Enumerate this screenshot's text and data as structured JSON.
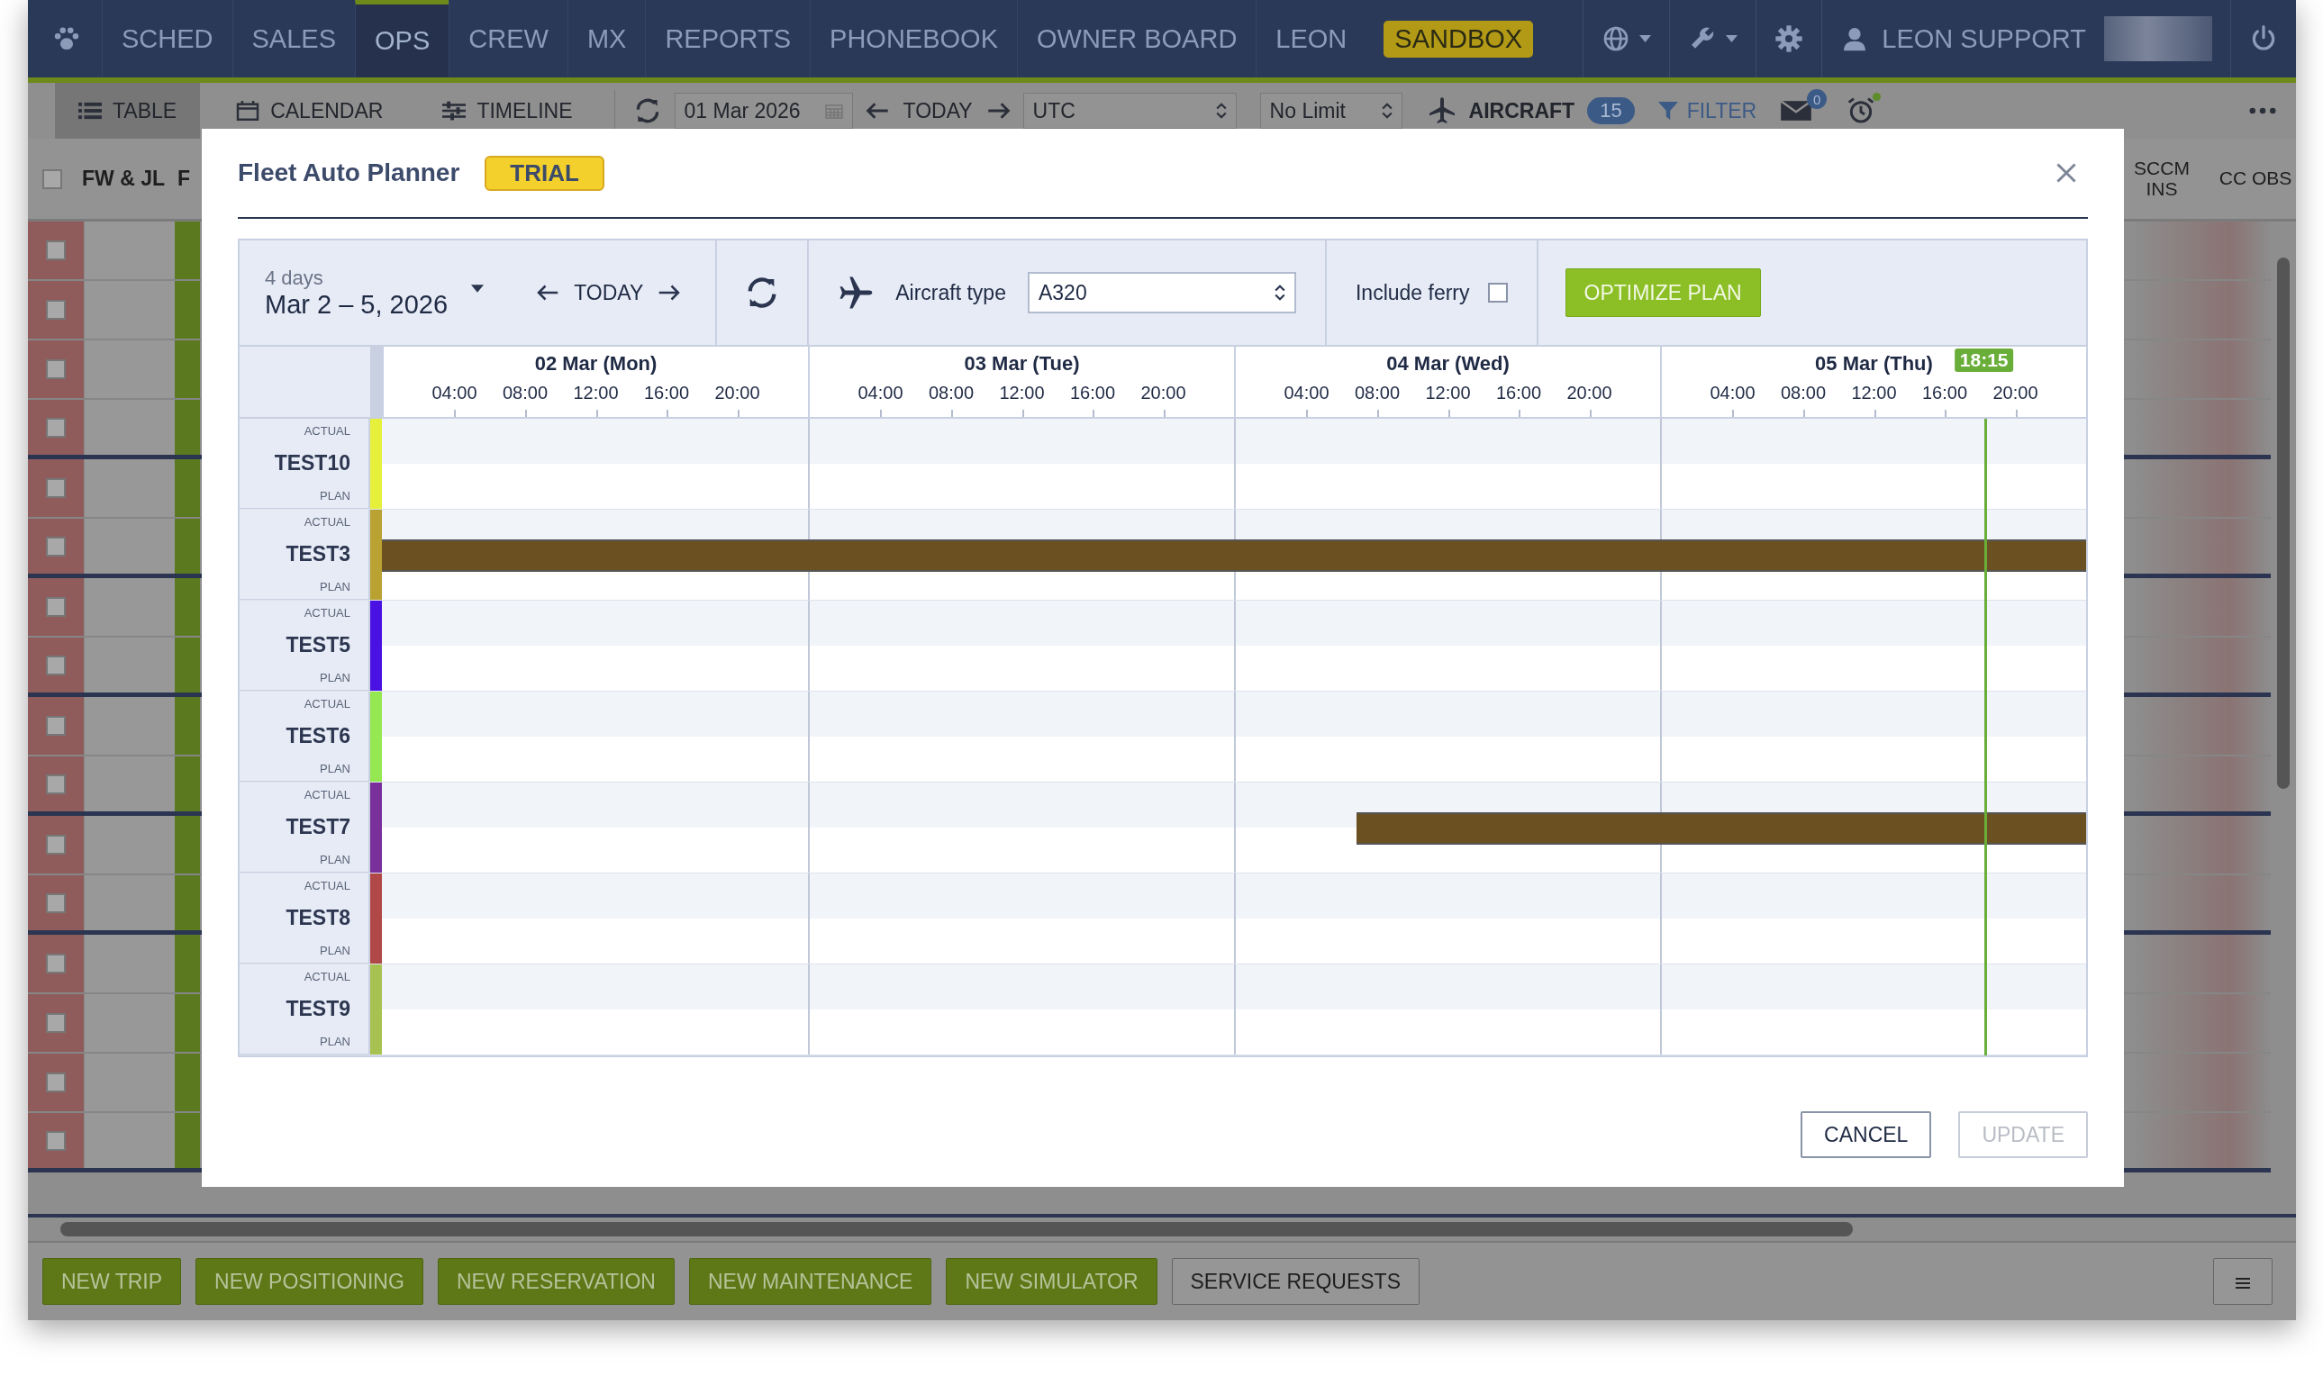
{
  "nav": {
    "items": [
      {
        "label": "SCHED",
        "selected": false
      },
      {
        "label": "SALES",
        "selected": false
      },
      {
        "label": "OPS",
        "selected": true
      },
      {
        "label": "CREW",
        "selected": false
      },
      {
        "label": "MX",
        "selected": false
      },
      {
        "label": "REPORTS",
        "selected": false
      },
      {
        "label": "PHONEBOOK",
        "selected": false
      },
      {
        "label": "OWNER BOARD",
        "selected": false
      },
      {
        "label": "LEON",
        "selected": false
      }
    ],
    "sandbox": "SANDBOX",
    "user": "LEON SUPPORT"
  },
  "toolbar": {
    "views": [
      {
        "label": "TABLE",
        "kind": "table",
        "selected": true
      },
      {
        "label": "CALENDAR",
        "kind": "calendar",
        "selected": false
      },
      {
        "label": "TIMELINE",
        "kind": "timeline",
        "selected": false
      }
    ],
    "date": "01 Mar 2026",
    "today": "TODAY",
    "timezone": "UTC",
    "limit": "No Limit",
    "aircraft": "AIRCRAFT",
    "aircraft_count": "15",
    "filter": "FILTER",
    "mail_count": "0"
  },
  "table": {
    "select_all": {
      "checked": false
    },
    "columns": [
      "FW & JL",
      "F"
    ],
    "right_columns": [
      "SCCM INS",
      "CC OBS"
    ],
    "rows": [
      {
        "checked": false,
        "group_end": false
      },
      {
        "checked": false,
        "group_end": false
      },
      {
        "checked": false,
        "group_end": false
      },
      {
        "checked": false,
        "group_end": true
      },
      {
        "checked": false,
        "group_end": false
      },
      {
        "checked": false,
        "group_end": true
      },
      {
        "checked": false,
        "group_end": false
      },
      {
        "checked": false,
        "group_end": true
      },
      {
        "checked": false,
        "group_end": false
      },
      {
        "checked": false,
        "group_end": true
      },
      {
        "checked": false,
        "group_end": false
      },
      {
        "checked": false,
        "group_end": true
      },
      {
        "checked": false,
        "group_end": false
      },
      {
        "checked": false,
        "group_end": false
      },
      {
        "checked": false,
        "group_end": false
      },
      {
        "checked": false,
        "group_end": true
      }
    ]
  },
  "planner": {
    "title": "Fleet Auto Planner",
    "badge": "TRIAL",
    "range_caption": "4 days",
    "range": "Mar 2 – 5, 2026",
    "today": "TODAY",
    "aircraft_type_label": "Aircraft type",
    "aircraft_type": "A320",
    "include_ferry": {
      "label": "Include ferry",
      "checked": false
    },
    "optimize": "OPTIMIZE PLAN",
    "days": [
      {
        "label": "02 Mar (Mon)",
        "hours": [
          "04:00",
          "08:00",
          "12:00",
          "16:00",
          "20:00"
        ]
      },
      {
        "label": "03 Mar (Tue)",
        "hours": [
          "04:00",
          "08:00",
          "12:00",
          "16:00",
          "20:00"
        ]
      },
      {
        "label": "04 Mar (Wed)",
        "hours": [
          "04:00",
          "08:00",
          "12:00",
          "16:00",
          "20:00"
        ]
      },
      {
        "label": "05 Mar (Thu)",
        "hours": [
          "04:00",
          "08:00",
          "12:00",
          "16:00",
          "20:00"
        ],
        "now": "18:15"
      }
    ],
    "aircraft": [
      {
        "actual_label": "ACTUAL",
        "name": "TEST10",
        "plan_label": "PLAN",
        "color": "#e6f03a"
      },
      {
        "actual_label": "ACTUAL",
        "name": "TEST3",
        "plan_label": "PLAN",
        "color": "#b9a232",
        "bar": {
          "level": 1
        }
      },
      {
        "actual_label": "ACTUAL",
        "name": "TEST5",
        "plan_label": "PLAN",
        "color": "#4a12e2"
      },
      {
        "actual_label": "ACTUAL",
        "name": "TEST6",
        "plan_label": "PLAN",
        "color": "#96e852"
      },
      {
        "actual_label": "ACTUAL",
        "name": "TEST7",
        "plan_label": "PLAN",
        "color": "#7a309a",
        "bar": {
          "level": 0.428
        }
      },
      {
        "actual_label": "ACTUAL",
        "name": "TEST8",
        "plan_label": "PLAN",
        "color": "#b04848"
      },
      {
        "actual_label": "ACTUAL",
        "name": "TEST9",
        "plan_label": "PLAN",
        "color": "#a8c252"
      }
    ],
    "cancel": "CANCEL",
    "update": {
      "label": "UPDATE",
      "disabled": true
    }
  },
  "bottom_bar": {
    "buttons": [
      {
        "label": "NEW TRIP",
        "kind": "primary"
      },
      {
        "label": "NEW POSITIONING",
        "kind": "primary"
      },
      {
        "label": "NEW RESERVATION",
        "kind": "primary"
      },
      {
        "label": "NEW MAINTENANCE",
        "kind": "primary"
      },
      {
        "label": "NEW SIMULATOR",
        "kind": "primary"
      },
      {
        "label": "SERVICE REQUESTS",
        "kind": "secondary"
      }
    ]
  }
}
